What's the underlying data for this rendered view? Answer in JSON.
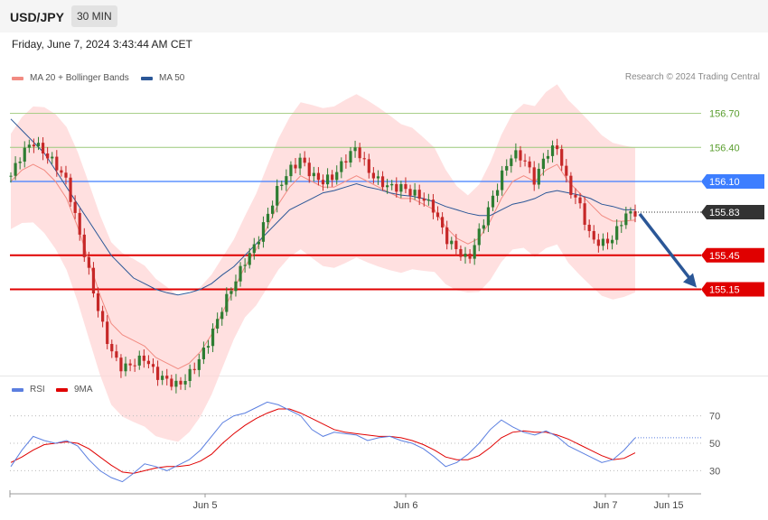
{
  "header": {
    "symbol": "USD/JPY",
    "timeframe": "30 MIN"
  },
  "datetime": "Friday, June 7, 2024 3:43:44 AM CET",
  "legend_main": [
    {
      "label": "MA 20 + Bollinger Bands",
      "color": "#f28b82"
    },
    {
      "label": "MA 50",
      "color": "#2b5797"
    }
  ],
  "legend_rsi": [
    {
      "label": "RSI",
      "color": "#5b7fe0"
    },
    {
      "label": "9MA",
      "color": "#e00000"
    }
  ],
  "credit": "Research © 2024 Trading Central",
  "colors": {
    "bull": "#2e7d32",
    "bear": "#c62828",
    "band_fill": "#ffd6d6",
    "ma20": "#f28b82",
    "ma50": "#2b5797",
    "support": "#e00000",
    "pivot": "#3d7eff",
    "resistance": "#9bc97a",
    "arrow": "#2b5797",
    "current_tag": "#333333"
  },
  "chart_data": [
    {
      "type": "candlestick",
      "title": "USD/JPY",
      "timeframe": "30 MIN",
      "xlabels": [
        "Jun 5",
        "Jun 6",
        "Jun 7",
        "Jun 15"
      ],
      "ylim": [
        154.0,
        157.5
      ],
      "close_path": [
        156.15,
        156.35,
        156.45,
        156.35,
        156.25,
        156.1,
        155.7,
        155.3,
        154.9,
        154.6,
        154.45,
        154.5,
        154.55,
        154.4,
        154.35,
        154.3,
        154.4,
        154.55,
        154.75,
        155.0,
        155.2,
        155.4,
        155.55,
        155.8,
        156.05,
        156.2,
        156.3,
        156.15,
        156.1,
        156.15,
        156.3,
        156.4,
        156.2,
        156.1,
        156.05,
        156.05,
        156.0,
        155.95,
        155.85,
        155.6,
        155.5,
        155.4,
        155.65,
        155.9,
        156.15,
        156.35,
        156.3,
        156.1,
        156.35,
        156.4,
        156.05,
        155.9,
        155.6,
        155.55,
        155.6,
        155.8,
        155.83
      ],
      "series": [
        {
          "name": "MA 20 + Bollinger Bands",
          "values": [
            156.1,
            156.2,
            156.25,
            156.2,
            156.1,
            155.95,
            155.7,
            155.4,
            155.1,
            154.85,
            154.75,
            154.7,
            154.65,
            154.55,
            154.5,
            154.45,
            154.5,
            154.6,
            154.75,
            154.95,
            155.15,
            155.35,
            155.5,
            155.7,
            155.9,
            156.05,
            156.15,
            156.1,
            156.05,
            156.05,
            156.1,
            156.15,
            156.1,
            156.05,
            156.0,
            155.95,
            155.95,
            155.9,
            155.85,
            155.7,
            155.6,
            155.55,
            155.6,
            155.75,
            155.95,
            156.1,
            156.15,
            156.1,
            156.2,
            156.25,
            156.1,
            156.0,
            155.9,
            155.8,
            155.75,
            155.75,
            155.76
          ]
        },
        {
          "name": "MA 50",
          "values": [
            156.65,
            156.55,
            156.45,
            156.35,
            156.2,
            156.05,
            155.9,
            155.75,
            155.6,
            155.45,
            155.35,
            155.25,
            155.2,
            155.15,
            155.12,
            155.1,
            155.12,
            155.15,
            155.2,
            155.28,
            155.35,
            155.45,
            155.55,
            155.65,
            155.75,
            155.85,
            155.9,
            155.95,
            156.0,
            156.02,
            156.05,
            156.08,
            156.05,
            156.03,
            156.0,
            155.98,
            155.97,
            155.95,
            155.92,
            155.88,
            155.85,
            155.82,
            155.8,
            155.8,
            155.85,
            155.9,
            155.92,
            155.95,
            156.0,
            156.02,
            156.0,
            155.98,
            155.95,
            155.9,
            155.88,
            155.85,
            155.85
          ]
        }
      ],
      "levels": [
        {
          "label": "156.70",
          "value": 156.7,
          "role": "resistance"
        },
        {
          "label": "156.40",
          "value": 156.4,
          "role": "resistance"
        },
        {
          "label": "156.10",
          "value": 156.1,
          "role": "pivot"
        },
        {
          "label": "155.45",
          "value": 155.45,
          "role": "support"
        },
        {
          "label": "155.15",
          "value": 155.15,
          "role": "support"
        }
      ],
      "current_price": {
        "label": "155.83",
        "value": 155.83
      },
      "forecast_arrow": {
        "from": 155.83,
        "to": 155.15
      }
    },
    {
      "type": "line",
      "legend": [
        "RSI",
        "9MA"
      ],
      "ylim": [
        20,
        80
      ],
      "yticks": [
        {
          "label": "30",
          "value": 30
        },
        {
          "label": "50",
          "value": 50
        },
        {
          "label": "70",
          "value": 70
        }
      ],
      "series": [
        {
          "name": "RSI",
          "values": [
            33,
            45,
            55,
            52,
            50,
            52,
            48,
            38,
            30,
            25,
            22,
            28,
            35,
            33,
            30,
            34,
            38,
            45,
            55,
            65,
            70,
            72,
            76,
            80,
            78,
            74,
            70,
            60,
            55,
            58,
            57,
            56,
            52,
            54,
            55,
            52,
            50,
            46,
            40,
            33,
            36,
            42,
            50,
            60,
            67,
            62,
            58,
            56,
            59,
            55,
            48,
            44,
            40,
            36,
            38,
            45,
            54
          ]
        },
        {
          "name": "9MA",
          "values": [
            36,
            40,
            45,
            49,
            50,
            51,
            50,
            46,
            40,
            34,
            29,
            28,
            30,
            32,
            33,
            33,
            34,
            37,
            42,
            50,
            57,
            63,
            68,
            72,
            75,
            75,
            72,
            68,
            64,
            60,
            58,
            57,
            56,
            55,
            55,
            54,
            52,
            49,
            45,
            40,
            38,
            38,
            41,
            47,
            54,
            58,
            59,
            58,
            58,
            56,
            53,
            49,
            45,
            41,
            38,
            39,
            43
          ]
        }
      ]
    }
  ]
}
